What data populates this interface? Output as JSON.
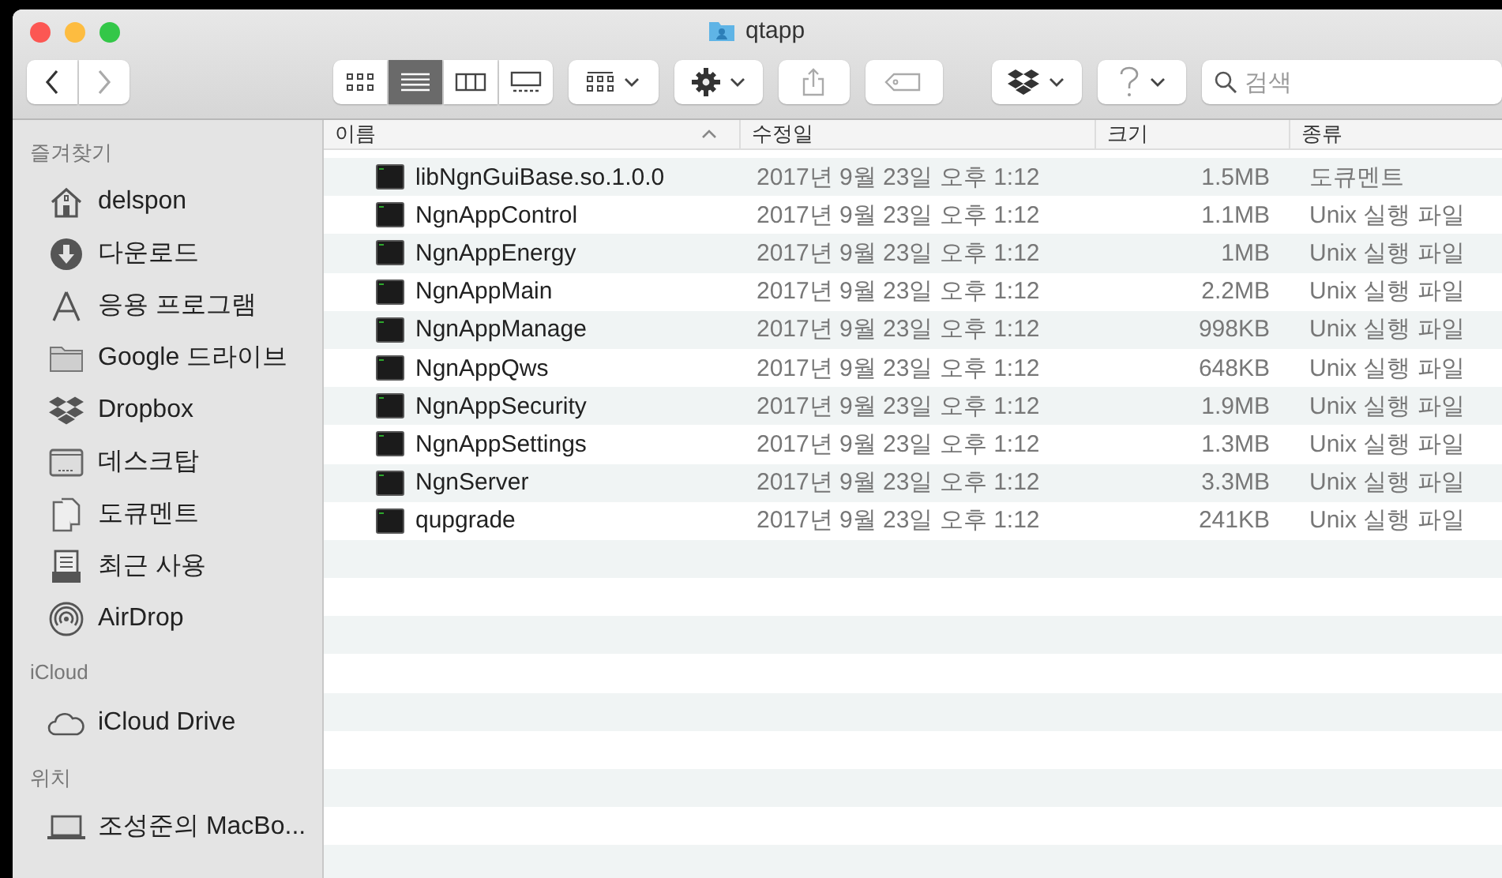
{
  "window": {
    "title": "qtapp"
  },
  "toolbar": {
    "views": [
      {
        "kind": "icons",
        "selected": false
      },
      {
        "kind": "list",
        "selected": true
      },
      {
        "kind": "columns",
        "selected": false
      },
      {
        "kind": "gallery",
        "selected": false
      }
    ],
    "search": {
      "placeholder": "검색"
    }
  },
  "sidebar": {
    "sections": [
      {
        "title": "즐겨찾기",
        "items": [
          {
            "kind": "home",
            "label": "delspon"
          },
          {
            "kind": "download",
            "label": "다운로드"
          },
          {
            "kind": "apps",
            "label": "응용 프로그램"
          },
          {
            "kind": "folder",
            "label": "Google 드라이브"
          },
          {
            "kind": "dropbox",
            "label": "Dropbox"
          },
          {
            "kind": "desktop",
            "label": "데스크탑"
          },
          {
            "kind": "documents",
            "label": "도큐멘트"
          },
          {
            "kind": "recents",
            "label": "최근 사용"
          },
          {
            "kind": "airdrop",
            "label": "AirDrop"
          }
        ]
      },
      {
        "title": "iCloud",
        "items": [
          {
            "kind": "cloud",
            "label": "iCloud Drive"
          }
        ]
      },
      {
        "title": "위치",
        "items": [
          {
            "kind": "laptop",
            "label": "조성준의 MacBo..."
          }
        ]
      }
    ]
  },
  "table": {
    "columns": [
      {
        "label": "이름",
        "sorted": true
      },
      {
        "label": "수정일",
        "sorted": false
      },
      {
        "label": "크기",
        "sorted": false
      },
      {
        "label": "종류",
        "sorted": false
      }
    ],
    "rows": [
      {
        "name": "libNgnGuiBase.so.1.0.0",
        "modified": "2017년 9월 23일 오후 1:12",
        "size": "1.5MB",
        "kind": "도큐멘트"
      },
      {
        "name": "NgnAppControl",
        "modified": "2017년 9월 23일 오후 1:12",
        "size": "1.1MB",
        "kind": "Unix 실행 파일"
      },
      {
        "name": "NgnAppEnergy",
        "modified": "2017년 9월 23일 오후 1:12",
        "size": "1MB",
        "kind": "Unix 실행 파일"
      },
      {
        "name": "NgnAppMain",
        "modified": "2017년 9월 23일 오후 1:12",
        "size": "2.2MB",
        "kind": "Unix 실행 파일"
      },
      {
        "name": "NgnAppManage",
        "modified": "2017년 9월 23일 오후 1:12",
        "size": "998KB",
        "kind": "Unix 실행 파일"
      },
      {
        "name": "NgnAppQws",
        "modified": "2017년 9월 23일 오후 1:12",
        "size": "648KB",
        "kind": "Unix 실행 파일"
      },
      {
        "name": "NgnAppSecurity",
        "modified": "2017년 9월 23일 오후 1:12",
        "size": "1.9MB",
        "kind": "Unix 실행 파일"
      },
      {
        "name": "NgnAppSettings",
        "modified": "2017년 9월 23일 오후 1:12",
        "size": "1.3MB",
        "kind": "Unix 실행 파일"
      },
      {
        "name": "NgnServer",
        "modified": "2017년 9월 23일 오후 1:12",
        "size": "3.3MB",
        "kind": "Unix 실행 파일"
      },
      {
        "name": "qupgrade",
        "modified": "2017년 9월 23일 오후 1:12",
        "size": "241KB",
        "kind": "Unix 실행 파일"
      }
    ]
  }
}
